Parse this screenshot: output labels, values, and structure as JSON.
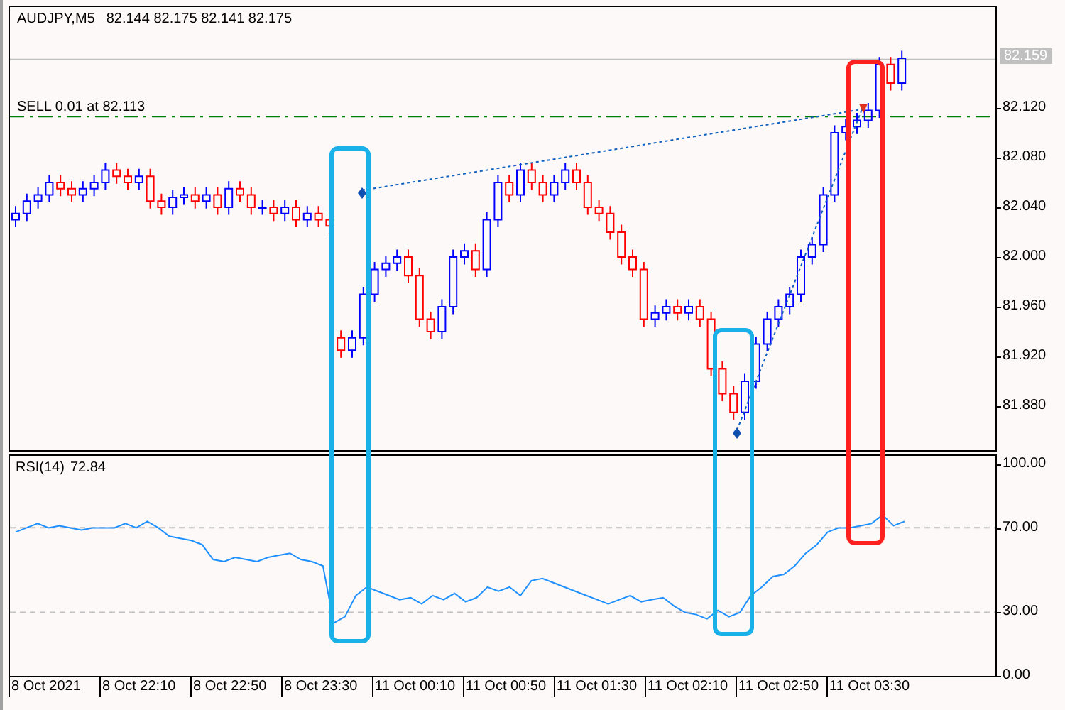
{
  "chart": {
    "symbol": "AUDJPY,M5",
    "ohlc": "82.144 82.175 82.141 82.175",
    "order_label": "SELL 0.01 at 82.113",
    "current_price": "82.159",
    "price_axis": [
      "82.120",
      "82.080",
      "82.040",
      "82.000",
      "81.960",
      "81.920",
      "81.880"
    ]
  },
  "indicator": {
    "value": "72.84",
    "chart_data": {
      "type": "line",
      "ylim": [
        0,
        104
      ],
      "grid": true,
      "yticks": [
        {
          "value": 0,
          "label": "0.00"
        },
        {
          "value": 30,
          "label": "30.00"
        },
        {
          "value": 70,
          "label": "70.00"
        },
        {
          "value": 100,
          "label": "100.00"
        }
      ],
      "series": [
        {
          "name": "RSI(14)",
          "color": "#1e90ff",
          "values": [
            68,
            70,
            72,
            70,
            71,
            70,
            69,
            70,
            70,
            70,
            72,
            70,
            73,
            70,
            66,
            65,
            64,
            62,
            55,
            54,
            56,
            55,
            54,
            56,
            57,
            58,
            55,
            54,
            52,
            25,
            28,
            38,
            42,
            40,
            38,
            36,
            37,
            34,
            38,
            36,
            39,
            35,
            37,
            42,
            40,
            42,
            38,
            45,
            46,
            44,
            42,
            40,
            38,
            36,
            34,
            36,
            38,
            35,
            36,
            37,
            33,
            30,
            29,
            27,
            31,
            28,
            30,
            38,
            42,
            47,
            48,
            52,
            58,
            62,
            68,
            70,
            70,
            71,
            72,
            76,
            71,
            73
          ]
        }
      ]
    }
  },
  "time_axis": [
    "8 Oct 2021",
    "8 Oct 22:10",
    "8 Oct 22:50",
    "8 Oct 23:30",
    "11 Oct 00:10",
    "11 Oct 00:50",
    "11 Oct 01:30",
    "11 Oct 02:10",
    "11 Oct 02:50",
    "11 Oct 03:30"
  ],
  "highlights": [
    {
      "color": "#1ab0e8"
    },
    {
      "color": "#1ab0e8"
    },
    {
      "color": "#ff2020"
    }
  ]
}
